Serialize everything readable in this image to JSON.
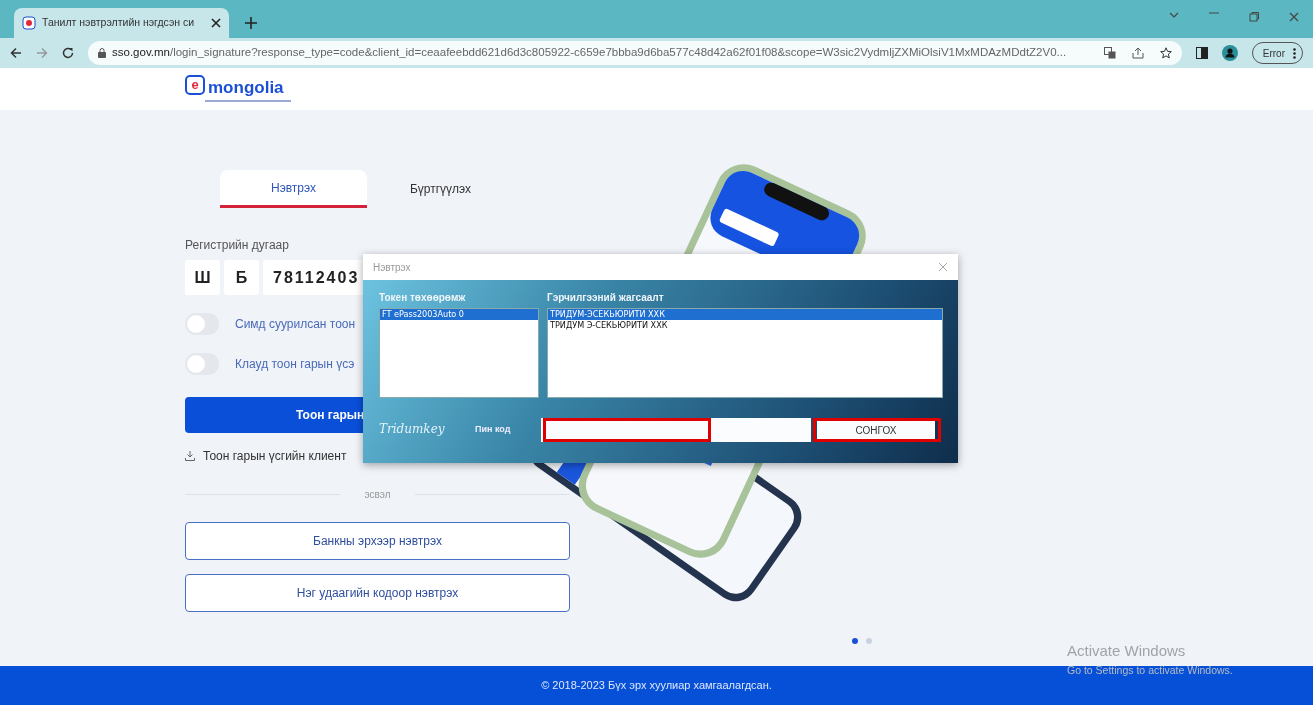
{
  "browser": {
    "tab_title": "Танилт нэвтрэлтийн нэгдсэн си",
    "url_host": "sso.gov.mn",
    "url_path": "/login_signature?response_type=code&client_id=ceaafeebdd621d6d3c805922-c659e7bbba9d6ba577c48d42a62f01f08&scope=W3sic2VydmljZXMiOlsiV1MxMDAzMDdtZ2V0...",
    "profile_button": "Error"
  },
  "logo": {
    "badge": "e",
    "text": "mongolia"
  },
  "tabs": [
    {
      "label": "Нэвтрэх",
      "selected": true
    },
    {
      "label": "Бүртгүүлэх",
      "selected": false
    }
  ],
  "form": {
    "reg_label": "Регистрийн дугаар",
    "reg_letters": [
      "Ш",
      "Б"
    ],
    "reg_number": "78112403",
    "toggles": [
      {
        "label": "Симд суурилсан тоон",
        "on": false
      },
      {
        "label": "Клауд тоон гарын үсэ",
        "on": false
      }
    ],
    "primary_button": "Тоон гарын",
    "download_link": "Тоон гарын үсгийн клиент",
    "divider": "эсвэл",
    "alt_buttons": [
      "Банкны эрхээр нэвтрэх",
      "Нэг удаагийн кодоор нэвтрэх"
    ]
  },
  "carousel_dots": [
    {
      "selected": true
    },
    {
      "selected": false
    }
  ],
  "dialog": {
    "title": "Нэвтрэх",
    "token_label": "Токен төхөөрөмж",
    "token_list": [
      {
        "text": "FT ePass2003Auto 0",
        "selected": true
      }
    ],
    "cert_label": "Гэрчилгээний жагсаалт",
    "cert_list": [
      {
        "text": "ТРИДУМ-ЭСЕКЬЮРИТИ ХХК",
        "selected": true
      },
      {
        "text": "ТРИДУМ Э-СЕКЬЮРИТИ ХХК",
        "selected": false
      }
    ],
    "brand": "Tridumkey",
    "pin_label": "Пин код",
    "select_button": "СОНГОХ"
  },
  "footer": "© 2018-2023 Бүх эрх хуулиар хамгаалагдсан.",
  "os_notice": {
    "title": "Activate Windows",
    "subtitle": "Go to Settings to activate Windows."
  }
}
